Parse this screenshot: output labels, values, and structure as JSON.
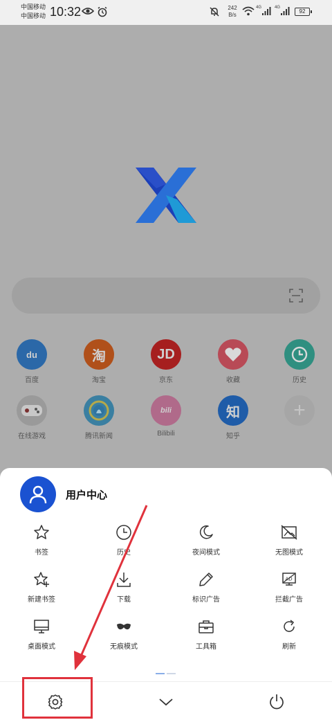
{
  "status_bar": {
    "carrier1": "中国移动",
    "carrier2": "中国移动",
    "time": "10:32",
    "net_speed_value": "242",
    "net_speed_unit": "B/s",
    "signal1_label": "4G",
    "signal2_label": "4G",
    "battery": "92"
  },
  "shortcuts_row1": [
    {
      "label": "百度",
      "icon": "baidu-icon",
      "glyph": "du",
      "color": "#2b68a8"
    },
    {
      "label": "淘宝",
      "icon": "taobao-icon",
      "glyph": "淘",
      "color": "#b0501a"
    },
    {
      "label": "京东",
      "icon": "jd-icon",
      "glyph": "JD",
      "color": "#a61f1f"
    },
    {
      "label": "收藏",
      "icon": "heart-icon",
      "glyph": "",
      "color": "#b84a56"
    },
    {
      "label": "历史",
      "icon": "clock-icon",
      "glyph": "",
      "color": "#2f8f80"
    }
  ],
  "shortcuts_row2": [
    {
      "label": "在线游戏",
      "icon": "gamepad-icon",
      "glyph": "",
      "color": "#9a9a9a"
    },
    {
      "label": "腾讯新闻",
      "icon": "tencent-news-icon",
      "glyph": "",
      "color": "#3a7fa1"
    },
    {
      "label": "Bilibili",
      "icon": "bilibili-icon",
      "glyph": "bili",
      "color": "#b06a8a"
    },
    {
      "label": "知乎",
      "icon": "zhihu-icon",
      "glyph": "知",
      "color": "#1f5ca8"
    },
    {
      "label": "",
      "icon": "add-icon",
      "glyph": "+",
      "color": "#a6a6a6"
    }
  ],
  "sheet": {
    "user_center": "用户中心",
    "menu": [
      {
        "label": "书签",
        "icon": "star-icon"
      },
      {
        "label": "历史",
        "icon": "clock-icon"
      },
      {
        "label": "夜间模式",
        "icon": "moon-icon"
      },
      {
        "label": "无图模式",
        "icon": "no-image-icon"
      },
      {
        "label": "新建书签",
        "icon": "star-plus-icon"
      },
      {
        "label": "下载",
        "icon": "download-icon"
      },
      {
        "label": "标识广告",
        "icon": "pen-icon"
      },
      {
        "label": "拦截广告",
        "icon": "ad-block-icon"
      },
      {
        "label": "桌面模式",
        "icon": "monitor-icon"
      },
      {
        "label": "无痕模式",
        "icon": "mask-icon"
      },
      {
        "label": "工具箱",
        "icon": "toolbox-icon"
      },
      {
        "label": "刷新",
        "icon": "refresh-icon"
      }
    ]
  },
  "colors": {
    "avatar_blue": "#1a52d1",
    "highlight_red": "#e0323c"
  }
}
